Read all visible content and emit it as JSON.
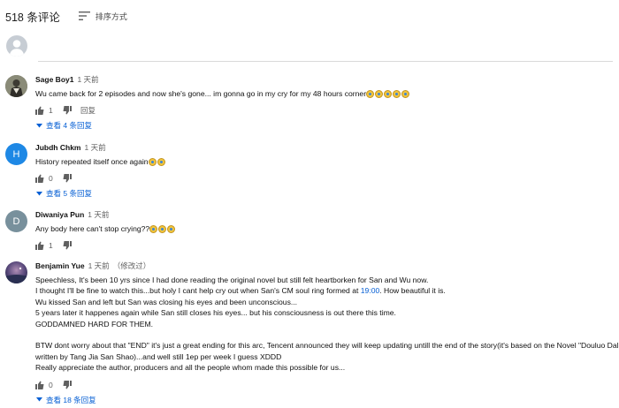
{
  "header": {
    "comment_count": "518 条评论",
    "sort_label": "排序方式"
  },
  "comments": [
    {
      "author": "Sage Boy1",
      "time": "1 天前",
      "edited": "",
      "lines": [
        "Wu came back for 2 episodes and now she's gone... im gonna go in my cry for my 48 hours corner"
      ],
      "emoji_count": 5,
      "likes": "1",
      "reply_label": "回复",
      "view_replies": "查看 4 条回复",
      "avatar_kind": "photo",
      "avatar_letter": ""
    },
    {
      "author": "Jubdh Chkm",
      "time": "1 天前",
      "edited": "",
      "lines": [
        "History repeated itself once again"
      ],
      "emoji_count": 2,
      "likes": "0",
      "reply_label": "",
      "view_replies": "查看 5 条回复",
      "avatar_kind": "letter",
      "avatar_letter": "H",
      "avatar_color": "#1e88e5"
    },
    {
      "author": "Diwaniya Pun",
      "time": "1 天前",
      "edited": "",
      "lines": [
        "Any body here can't stop crying??"
      ],
      "emoji_count": 3,
      "likes": "1",
      "reply_label": "",
      "view_replies": "",
      "avatar_kind": "letter",
      "avatar_letter": "D",
      "avatar_color": "#78909c"
    },
    {
      "author": "Benjamin Yue",
      "time": "1 天前",
      "edited": "（修改过）",
      "lines": [
        "Speechless, It's been 10 yrs since I had done reading the original novel but still felt heartborken for San and Wu now.",
        "I thought I'll be fine to watch this...but holy I cant help cry out when San's CM soul ring formed at ",
        "Wu kissed San and left but San was closing his eyes and been unconscious...",
        "5 years later it happenes again while San still closes his eyes... but his consciousness is out there this time.",
        "GODDAMNED HARD FOR THEM.",
        "",
        "BTW dont worry about that \"END\" it's just a great ending for this arc, Tencent announced they will keep updating untill the end of the story(it's based on the Novel \"Douluo Dalu\"",
        "written by Tang Jia San Shao)...and well still 1ep per week I guess XDDD",
        "Really appreciate the author, producers and all the people whom made this possible for us..."
      ],
      "timestamp_link": "19:00",
      "line2_suffix": ". How beautiful it is.",
      "likes": "0",
      "reply_label": "",
      "view_replies": "查看 18 条回复",
      "avatar_kind": "photo-night",
      "avatar_letter": ""
    }
  ],
  "colors": {
    "link": "#065fd4",
    "muted": "#606060",
    "divider": "#d9d9d9"
  }
}
